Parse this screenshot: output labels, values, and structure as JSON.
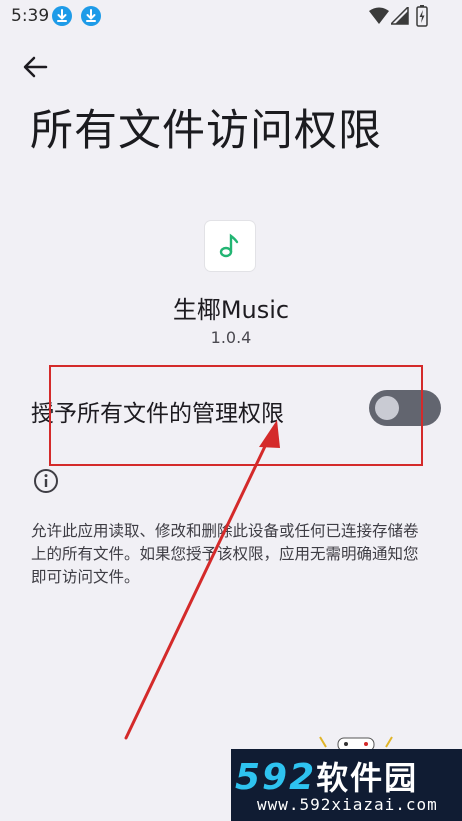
{
  "status_bar": {
    "time": "5:39",
    "icons": [
      "download-notification-icon",
      "download-notification-icon",
      "wifi-icon",
      "signal-icon",
      "battery-charging-icon"
    ]
  },
  "header": {
    "back_icon": "arrow-left-icon",
    "title": "所有文件访问权限"
  },
  "app": {
    "icon": "music-note-icon",
    "name": "生椰Music",
    "version": "1.0.4"
  },
  "permission": {
    "label": "授予所有文件的管理权限",
    "enabled": false
  },
  "info": {
    "icon": "info-icon",
    "text": "允许此应用读取、修改和删除此设备或任何已连接存储卷上的所有文件。如果您授予该权限，应用无需明确通知您即可访问文件。"
  },
  "annotation": {
    "highlight_color": "#d42a2a",
    "arrow_color": "#d42a2a"
  },
  "watermark": {
    "logo_digits": "592",
    "logo_text": "软件园",
    "url": "www.592xiazai.com"
  },
  "colors": {
    "background": "#f1f0f5",
    "toggle_off_track": "#62656f",
    "music_icon": "#22b573",
    "download_badge": "#1e9be8"
  }
}
